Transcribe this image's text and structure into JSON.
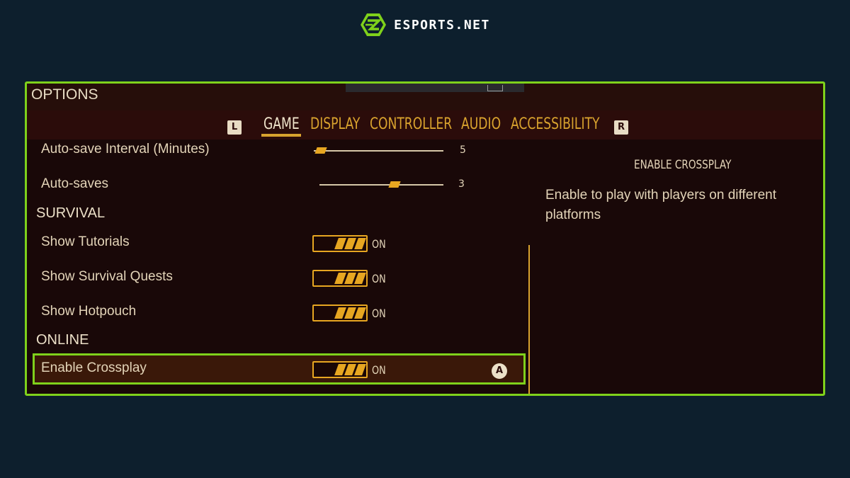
{
  "brand": {
    "name": "ESPORTS.NET",
    "icon": "esports-net-logo",
    "accent": "#7fd11b"
  },
  "header": {
    "title": "OPTIONS"
  },
  "tabs": {
    "left_bumper": "L",
    "right_bumper": "R",
    "items": [
      {
        "label": "GAME",
        "active": true
      },
      {
        "label": "DISPLAY",
        "active": false
      },
      {
        "label": "CONTROLLER",
        "active": false
      },
      {
        "label": "AUDIO",
        "active": false
      },
      {
        "label": "ACCESSIBILITY",
        "active": false
      }
    ]
  },
  "settings": {
    "autosave_interval": {
      "label": "Auto-save Interval (Minutes)",
      "value": "5",
      "level": 0.0
    },
    "autosaves": {
      "label": "Auto-saves",
      "value": "3",
      "level": 0.55
    },
    "survival_heading": "SURVIVAL",
    "show_tutorials": {
      "label": "Show Tutorials",
      "state": "ON"
    },
    "show_survival_quests": {
      "label": "Show Survival Quests",
      "state": "ON"
    },
    "show_hotpouch": {
      "label": "Show Hotpouch",
      "state": "ON"
    },
    "online_heading": "ONLINE",
    "enable_crossplay": {
      "label": "Enable Crossplay",
      "state": "ON",
      "button_hint": "A"
    }
  },
  "description": {
    "title": "ENABLE CROSSPLAY",
    "body": "Enable to play with players on different platforms"
  },
  "colors": {
    "background": "#0d1f2d",
    "highlight": "#7fd11b",
    "gold": "#d9a32e",
    "panel": "#190808"
  }
}
